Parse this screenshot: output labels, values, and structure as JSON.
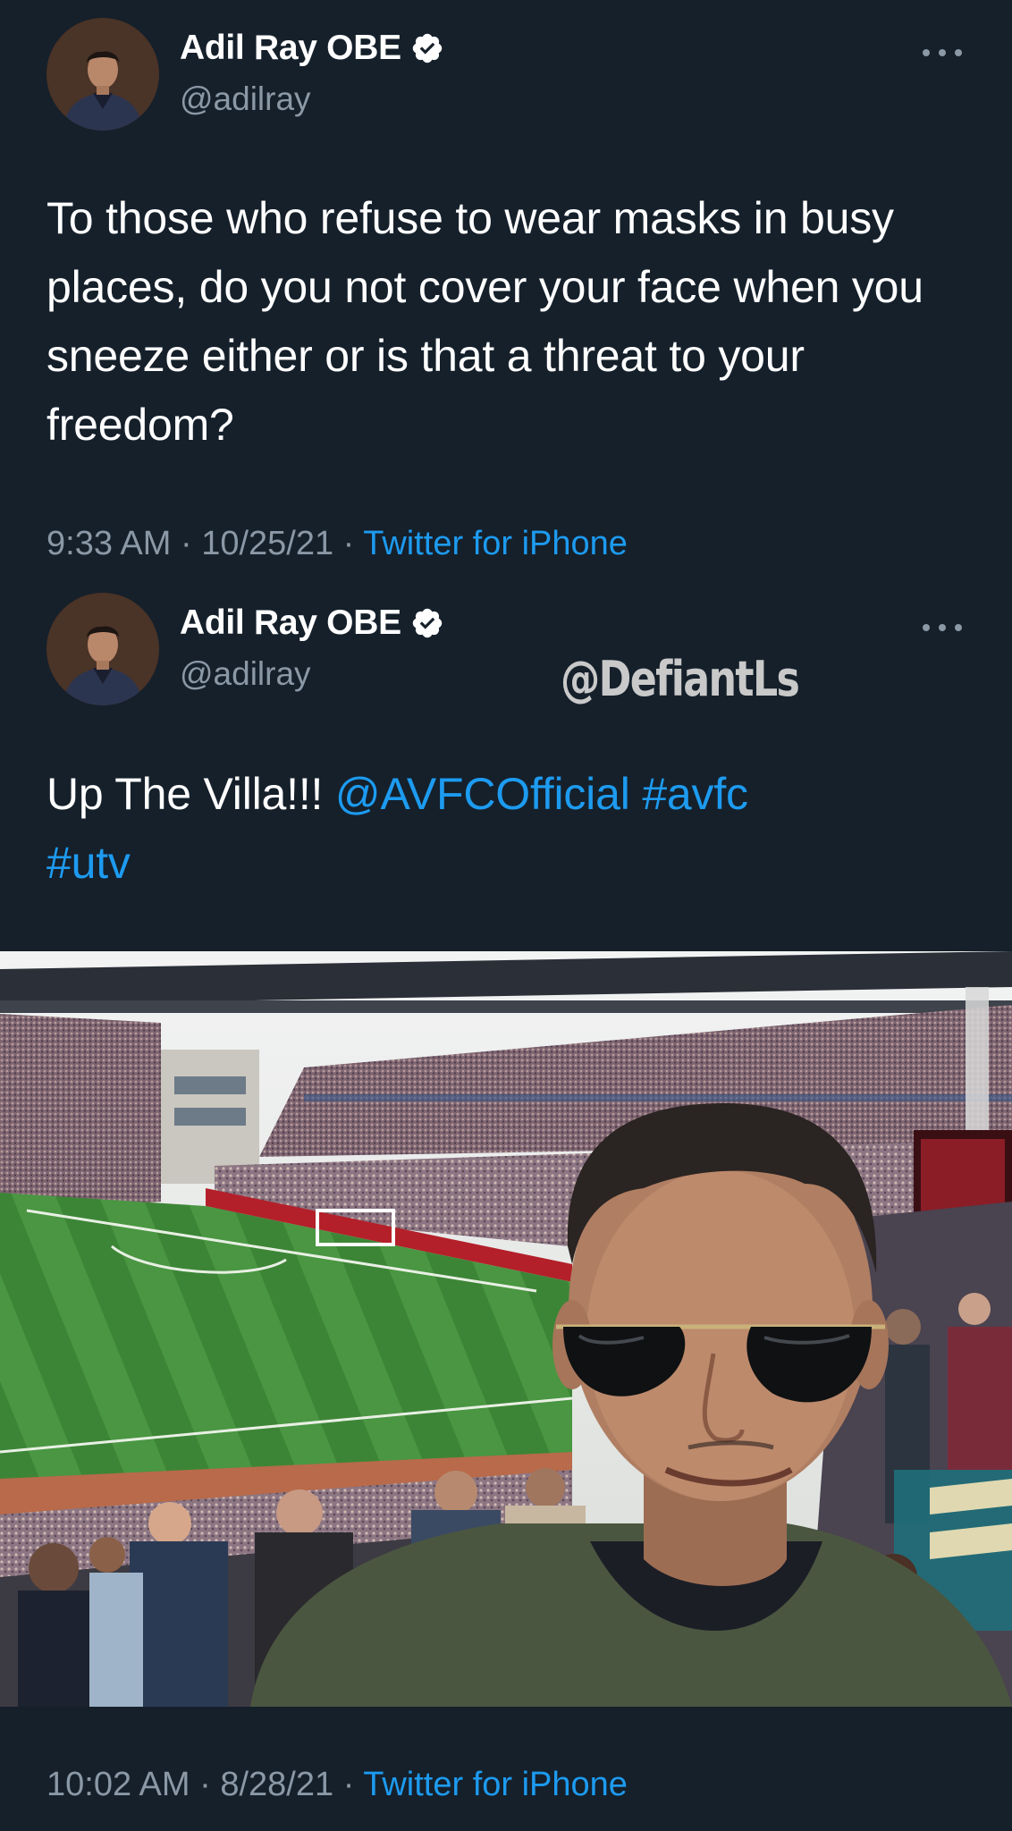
{
  "tweets": [
    {
      "author": {
        "name": "Adil Ray OBE",
        "handle": "@adilray",
        "verified": true
      },
      "text": "To those who refuse to wear masks in busy places, do you not cover your face when you sneeze either or is that a threat to your freedom?",
      "time": "9:33 AM",
      "date": "10/25/21",
      "source": "Twitter for iPhone"
    },
    {
      "author": {
        "name": "Adil Ray OBE",
        "handle": "@adilray",
        "verified": true
      },
      "text_plain": "Up The Villa!!! ",
      "mention": "@AVFCOfficial",
      "hashtags": [
        "#avfc",
        "#utv"
      ],
      "media": {
        "type": "photo",
        "description": "selfie at football stadium"
      },
      "time": "10:02 AM",
      "date": "8/28/21",
      "source": "Twitter for iPhone"
    }
  ],
  "watermark": "@DefiantLs",
  "separator": " · ",
  "icons": {
    "verified": "verified-badge-icon",
    "more": "more-options-icon"
  },
  "colors": {
    "background": "#15202b",
    "link": "#1d9bf0",
    "secondary": "#8b98a5",
    "text": "#ffffff"
  }
}
